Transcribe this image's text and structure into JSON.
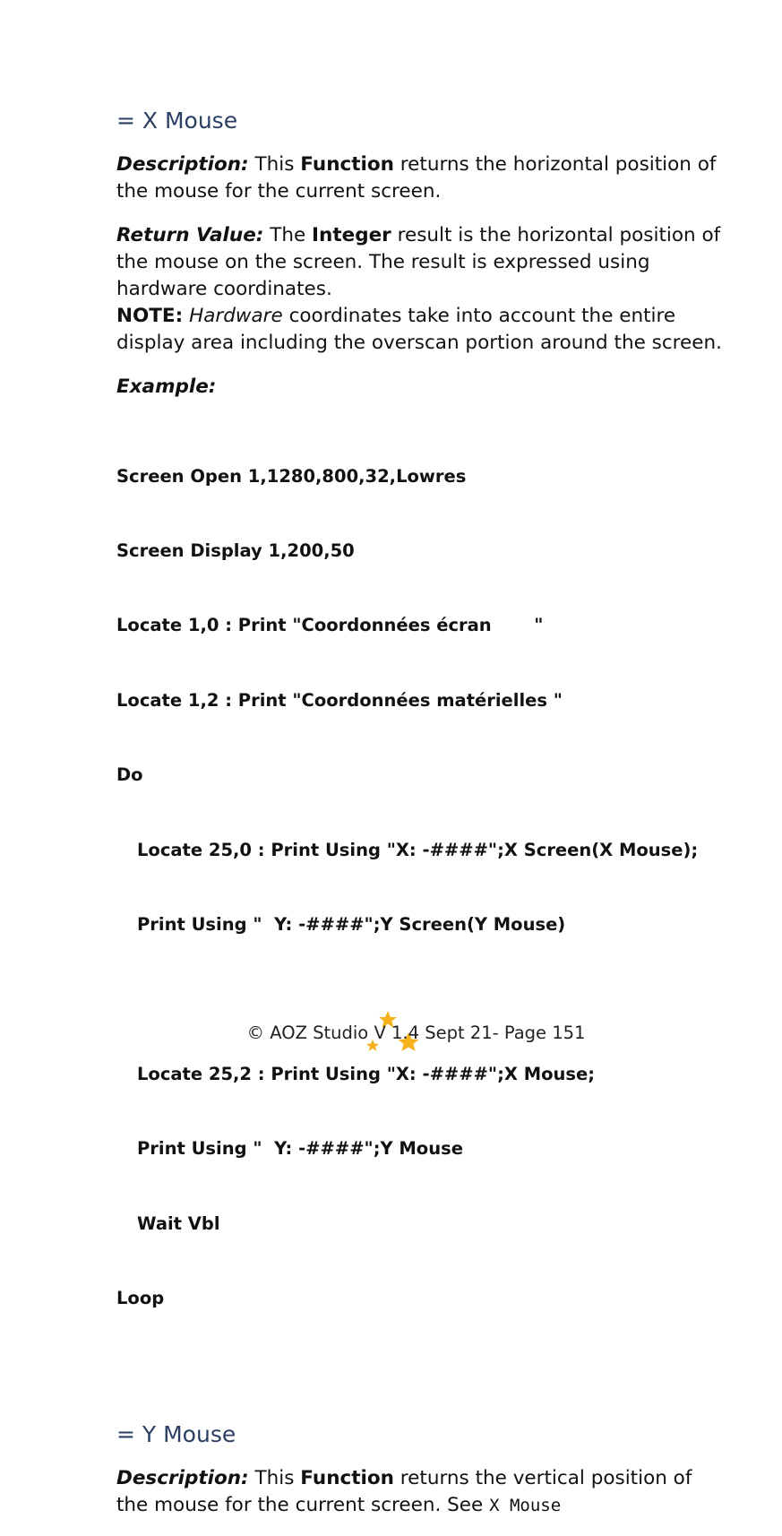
{
  "section1": {
    "heading": "= X Mouse",
    "description_label": "Description:",
    "description_pre": " This ",
    "description_bold": "Function",
    "description_post": " returns the horizontal position of the mouse for the current screen.",
    "return_label": "Return Value:",
    "return_pre": " The ",
    "return_bold": "Integer",
    "return_post": " result is the horizontal position of the mouse on the screen. The result is expressed using hardware coordinates.",
    "note_label": "NOTE:",
    "note_italic": "Hardware",
    "note_post": " coordinates take into account the entire display area including the overscan portion around the screen.",
    "example_label": "Example:",
    "code_lines": [
      "Screen Open 1,1280,800,32,Lowres",
      "Screen Display 1,200,50",
      "Locate 1,0 : Print \"Coordonnées écran       \"",
      "Locate 1,2 : Print \"Coordonnées matérielles \"",
      "Do",
      "Locate 25,0 : Print Using \"X: -####\";X Screen(X Mouse);",
      "Print Using \"  Y: -####\";Y Screen(Y Mouse)",
      "",
      "Locate 25,2 : Print Using \"X: -####\";X Mouse;",
      "Print Using \"  Y: -####\";Y Mouse",
      "Wait Vbl",
      "Loop"
    ]
  },
  "section2": {
    "heading": "= Y Mouse",
    "description_label": "Description:",
    "description_pre": " This ",
    "description_bold": "Function",
    "description_post": " returns the vertical position of the mouse for the current screen. See ",
    "see_ref": "X Mouse"
  },
  "footer": {
    "text": "© AOZ Studio V 1.4 Sept 21- Page 151"
  },
  "colors": {
    "heading": "#2b3f63",
    "star": "#f5b21b"
  }
}
